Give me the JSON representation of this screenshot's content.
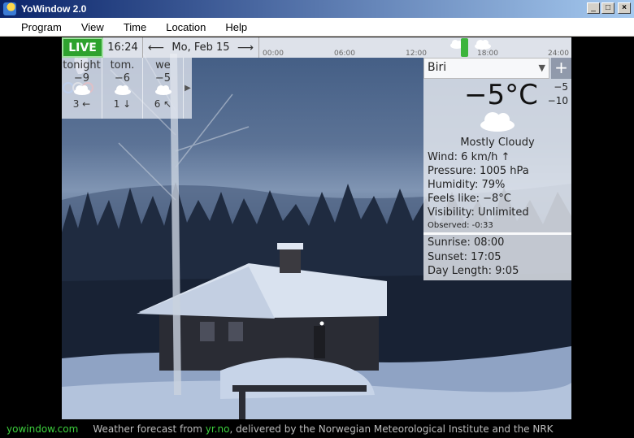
{
  "window": {
    "title": "YoWindow 2.0",
    "controls": [
      "_",
      "□",
      "×"
    ]
  },
  "menu": [
    "Program",
    "View",
    "Time",
    "Location",
    "Help"
  ],
  "topbar": {
    "live_label": "LIVE",
    "time": "16:24",
    "date": "Mo, Feb 15",
    "ticks": [
      "00:00",
      "06:00",
      "12:00",
      "18:00",
      "24:00"
    ]
  },
  "forecast": [
    {
      "label": "tonight",
      "temp": "−9",
      "wind": "3 ←"
    },
    {
      "label": "tom.",
      "temp": "−6",
      "wind": "1 ↓"
    },
    {
      "label": "we",
      "temp": "−5",
      "wind": "6 ↖"
    }
  ],
  "info": {
    "location": "Biri",
    "temperature": "−5°C",
    "high": "−5",
    "low": "−10",
    "condition": "Mostly Cloudy",
    "wind": "Wind:  6 km/h ↑",
    "pressure": "Pressure:  1005 hPa",
    "humidity": "Humidity:  79%",
    "feels_like": "Feels like:  −8°C",
    "visibility": "Visibility:  Unlimited",
    "observed": "Observed:  -0:33",
    "sunrise": "Sunrise:  08:00",
    "sunset": "Sunset:  17:05",
    "day_length": "Day Length:  9:05"
  },
  "footer": {
    "site": "yowindow.com",
    "credit_prefix": "Weather forecast from ",
    "credit_source": "yr.no",
    "credit_suffix": ", delivered by the Norwegian Meteorological Institute and the NRK"
  },
  "colors": {
    "live_green": "#2ea22e",
    "footer_link": "#3dd03d",
    "titlebar": "#0a246a"
  }
}
